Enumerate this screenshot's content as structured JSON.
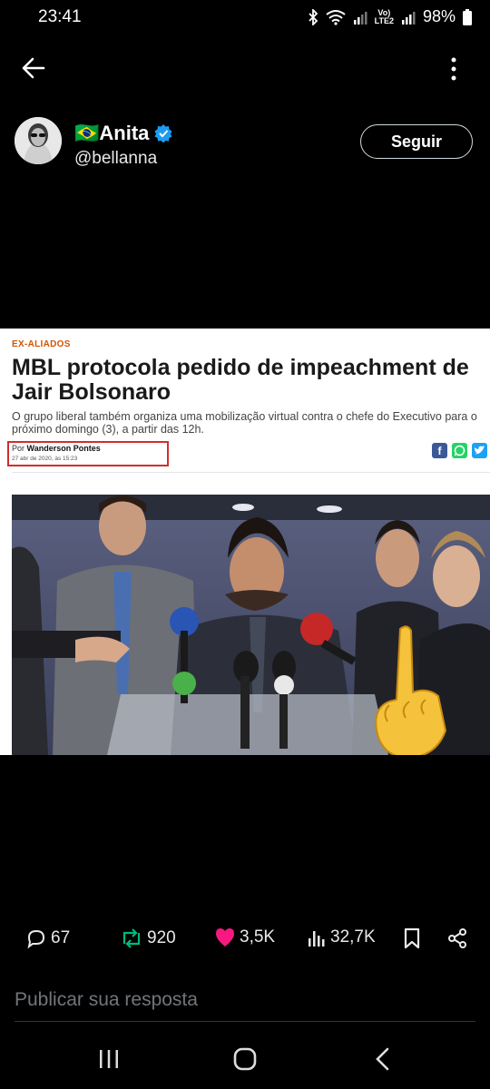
{
  "status_bar": {
    "time": "23:41",
    "network": "Vo)\nLTE2",
    "battery": "98%"
  },
  "profile": {
    "flag": "🇧🇷",
    "name": "Anita",
    "handle": "@bellanna",
    "follow_label": "Seguir"
  },
  "article": {
    "kicker": "EX-ALIADOS",
    "headline": "MBL protocola pedido de impeachment de Jair Bolsonaro",
    "summary": "O grupo liberal também organiza uma mobilização virtual contra o chefe do Executivo para o próximo domingo (3), a partir das 12h.",
    "byline_prefix": "Por",
    "author": "Wanderson Pontes",
    "date": "27 abr de 2020, às 15:23"
  },
  "actions": {
    "replies": "67",
    "retweets": "920",
    "likes": "3,5K",
    "views": "32,7K"
  },
  "reply_placeholder": "Publicar sua resposta",
  "colors": {
    "background": "#000000",
    "verified": "#1d9bf0",
    "retweet": "#00ba7c",
    "like": "#f91880",
    "kicker": "#d35400",
    "byline_box": "#d42c2c"
  }
}
